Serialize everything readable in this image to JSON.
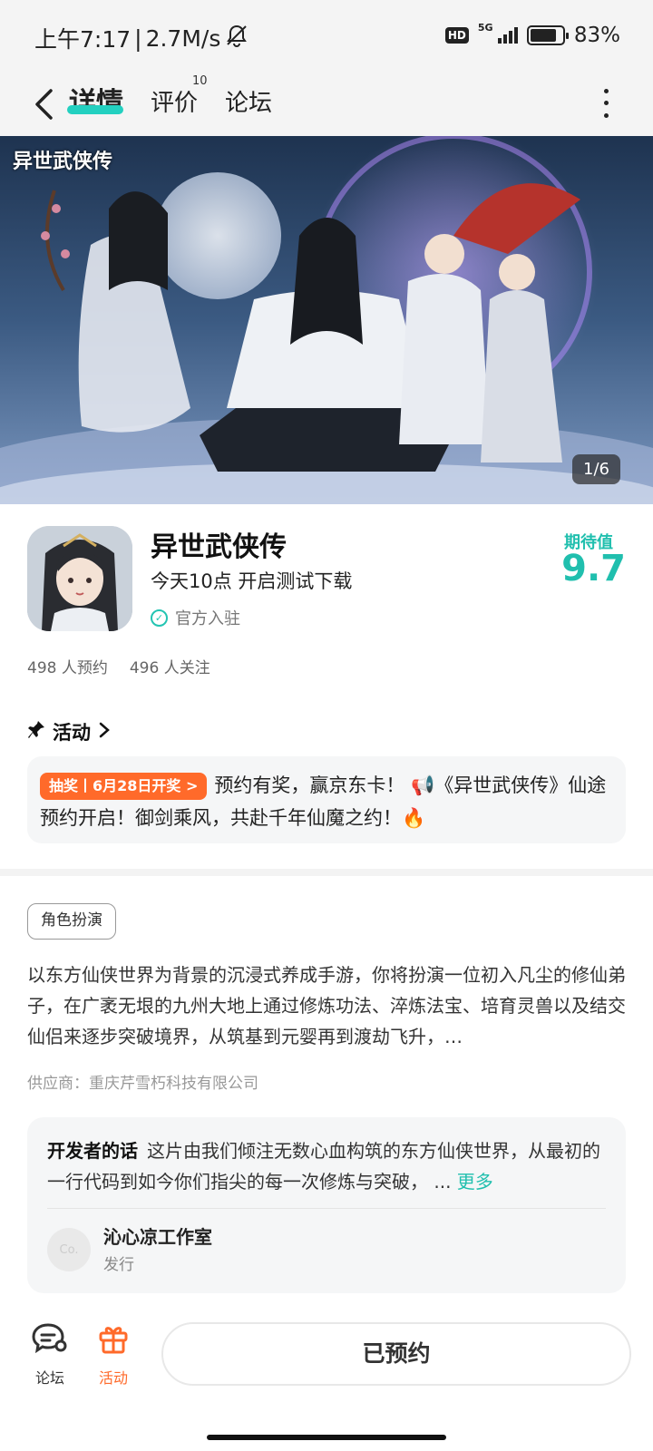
{
  "status_bar": {
    "time": "上午7:17",
    "speed": "2.7M/s",
    "hd": "HD",
    "network": "5G",
    "battery_level": 0.83,
    "battery_text": "83%"
  },
  "nav": {
    "tabs": [
      {
        "label": "详情",
        "active": true
      },
      {
        "label": "评价",
        "badge": "10"
      },
      {
        "label": "论坛"
      }
    ]
  },
  "banner": {
    "logo_text": "异世武侠传",
    "page_indicator": "1/6"
  },
  "app": {
    "title": "异世武侠传",
    "subtitle": "今天10点 开启测试下载",
    "official_label": "官方入驻",
    "score_label": "期待值",
    "score_value": "9.7",
    "reservations": "498 人预约",
    "followers": "496 人关注"
  },
  "activity": {
    "header": "活动",
    "badge": "抽奖丨6月28日开奖 >",
    "text": "预约有奖，赢京东卡！ 📢《异世武侠传》仙途预约开启！御剑乘风，共赴千年仙魔之约！🔥"
  },
  "details": {
    "genre_tag": "角色扮演",
    "description": "以东方仙侠世界为背景的沉浸式养成手游，你将扮演一位初入凡尘的修仙弟子，在广袤无垠的九州大地上通过修炼功法、淬炼法宝、培育灵兽以及结交仙侣来逐步突破境界，从筑基到元婴再到渡劫飞升，…",
    "supplier": "供应商：重庆芹雪朽科技有限公司"
  },
  "developer": {
    "label": "开发者的话",
    "text": "这片由我们倾注无数心血构筑的东方仙侠世界，从最初的一行代码到如今你们指尖的每一次修炼与突破， ...",
    "more": "更多",
    "avatar_text": "Co.",
    "name": "沁心凉工作室",
    "role": "发行"
  },
  "bottom_bar": {
    "forum_label": "论坛",
    "activity_label": "活动",
    "reserve_label": "已预约"
  },
  "colors": {
    "accent": "#20bfae",
    "orange": "#ff6a2a"
  }
}
